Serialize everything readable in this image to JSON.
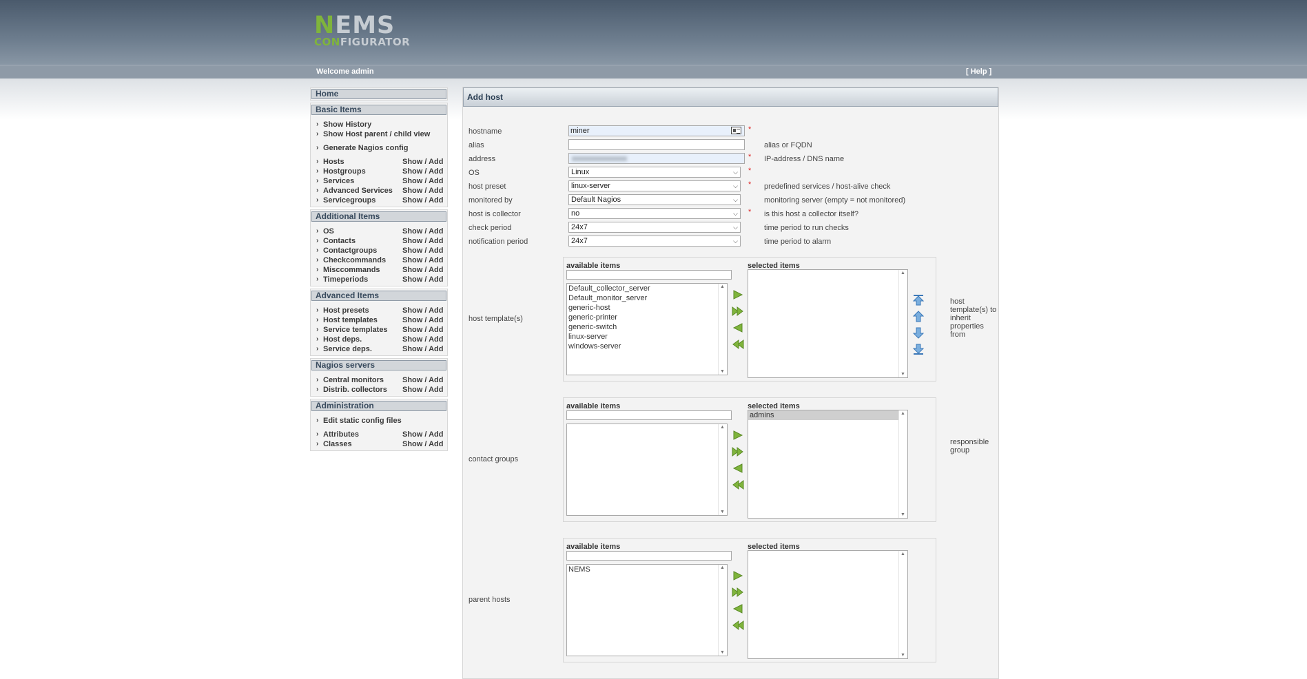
{
  "logo": {
    "line1_a": "N",
    "line1_b": "EMS",
    "line2_a": "CON",
    "line2_b": "FIGURATOR"
  },
  "topbar": {
    "welcome": "Welcome admin",
    "help": "[ Help ]"
  },
  "sidebar": {
    "home": "Home",
    "sections": [
      {
        "title": "Basic Items",
        "groups": [
          [
            {
              "label": "Show History"
            },
            {
              "label": "Show Host parent / child view"
            }
          ],
          [
            {
              "label": "Generate Nagios config"
            }
          ],
          [
            {
              "label": "Hosts",
              "actions": "Show / Add"
            },
            {
              "label": "Hostgroups",
              "actions": "Show / Add"
            },
            {
              "label": "Services",
              "actions": "Show / Add"
            },
            {
              "label": "Advanced Services",
              "actions": "Show / Add"
            },
            {
              "label": "Servicegroups",
              "actions": "Show / Add"
            }
          ]
        ]
      },
      {
        "title": "Additional Items",
        "groups": [
          [
            {
              "label": "OS",
              "actions": "Show / Add"
            },
            {
              "label": "Contacts",
              "actions": "Show / Add"
            },
            {
              "label": "Contactgroups",
              "actions": "Show / Add"
            },
            {
              "label": "Checkcommands",
              "actions": "Show / Add"
            },
            {
              "label": "Misccommands",
              "actions": "Show / Add"
            },
            {
              "label": "Timeperiods",
              "actions": "Show / Add"
            }
          ]
        ]
      },
      {
        "title": "Advanced Items",
        "groups": [
          [
            {
              "label": "Host presets",
              "actions": "Show / Add"
            },
            {
              "label": "Host templates",
              "actions": "Show / Add"
            },
            {
              "label": "Service templates",
              "actions": "Show / Add"
            },
            {
              "label": "Host deps.",
              "actions": "Show / Add"
            },
            {
              "label": "Service deps.",
              "actions": "Show / Add"
            }
          ]
        ]
      },
      {
        "title": "Nagios servers",
        "groups": [
          [
            {
              "label": "Central monitors",
              "actions": "Show / Add"
            },
            {
              "label": "Distrib. collectors",
              "actions": "Show / Add"
            }
          ]
        ]
      },
      {
        "title": "Administration",
        "groups": [
          [
            {
              "label": "Edit static config files"
            }
          ],
          [
            {
              "label": "Attributes",
              "actions": "Show / Add"
            },
            {
              "label": "Classes",
              "actions": "Show / Add"
            }
          ]
        ]
      }
    ]
  },
  "main": {
    "title": "Add host",
    "fields": {
      "hostname": {
        "label": "hostname",
        "value": "miner",
        "required": "*",
        "hint": ""
      },
      "alias": {
        "label": "alias",
        "value": "",
        "required": "",
        "hint": "alias or FQDN"
      },
      "address": {
        "label": "address",
        "value": "",
        "required": "*",
        "hint": "IP-address / DNS name"
      },
      "os": {
        "label": "OS",
        "value": "Linux",
        "required": "*",
        "hint": ""
      },
      "host_preset": {
        "label": "host preset",
        "value": "linux-server",
        "required": "*",
        "hint": "predefined services / host-alive check"
      },
      "monitored_by": {
        "label": "monitored by",
        "value": "Default Nagios",
        "required": "",
        "hint": "monitoring server (empty = not monitored)"
      },
      "host_is_collector": {
        "label": "host is collector",
        "value": "no",
        "required": "*",
        "hint": "is this host a collector itself?"
      },
      "check_period": {
        "label": "check period",
        "value": "24x7",
        "required": "",
        "hint": "time period to run checks"
      },
      "notification_period": {
        "label": "notification period",
        "value": "24x7",
        "required": "",
        "hint": "time period to alarm"
      }
    },
    "multiselect": {
      "available_label": "available items",
      "selected_label": "selected items",
      "host_templates": {
        "label": "host template(s)",
        "side_note": "host template(s) to inherit properties from",
        "available": [
          "Default_collector_server",
          "Default_monitor_server",
          "generic-host",
          "generic-printer",
          "generic-switch",
          "linux-server",
          "windows-server"
        ],
        "selected": []
      },
      "contact_groups": {
        "label": "contact groups",
        "side_note": "responsible group",
        "available": [],
        "selected": [
          "admins"
        ]
      },
      "parent_hosts": {
        "label": "parent hosts",
        "side_note": "",
        "available": [
          "NEMS"
        ],
        "selected": []
      }
    }
  },
  "colors": {
    "accent_green": "#7fb43c",
    "header_blue": "#4a5a6c",
    "required_red": "#dd2222"
  },
  "icons": {
    "move_right": "arrow-right-icon",
    "move_all_right": "double-arrow-right-icon",
    "move_left": "arrow-left-icon",
    "move_all_left": "double-arrow-left-icon",
    "order_top": "arrow-top-icon",
    "order_up": "arrow-up-icon",
    "order_down": "arrow-down-icon",
    "order_bottom": "arrow-bottom-icon"
  }
}
